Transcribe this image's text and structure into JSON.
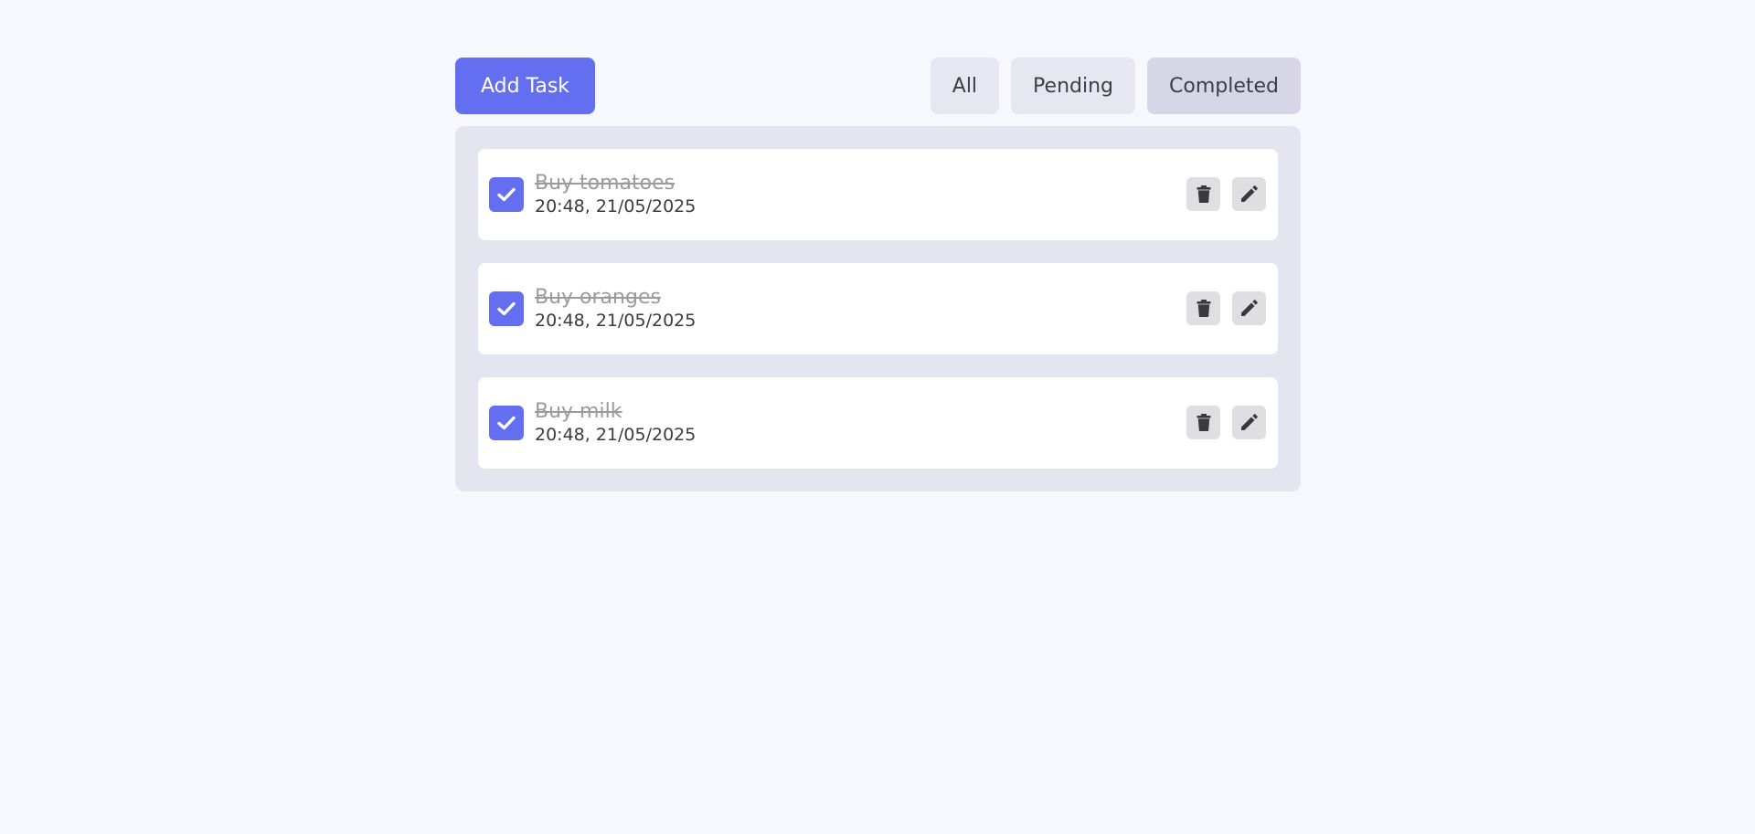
{
  "toolbar": {
    "add_label": "Add Task"
  },
  "filters": [
    {
      "label": "All",
      "active": false
    },
    {
      "label": "Pending",
      "active": false
    },
    {
      "label": "Completed",
      "active": true
    }
  ],
  "tasks": [
    {
      "title": "Buy tomatoes",
      "time": "20:48, 21/05/2025",
      "completed": true
    },
    {
      "title": "Buy oranges",
      "time": "20:48, 21/05/2025",
      "completed": true
    },
    {
      "title": "Buy milk",
      "time": "20:48, 21/05/2025",
      "completed": true
    }
  ],
  "icons": {
    "checkbox": "check-icon",
    "delete": "trash-icon",
    "edit": "pencil-icon"
  },
  "colors": {
    "accent": "#646ef0",
    "background": "#f7f8fd",
    "list_background": "#e5e5f0",
    "filter_active": "#d6d6e7",
    "filter_inactive": "#e7e7f2",
    "completed_text": "#9b9b9f"
  }
}
